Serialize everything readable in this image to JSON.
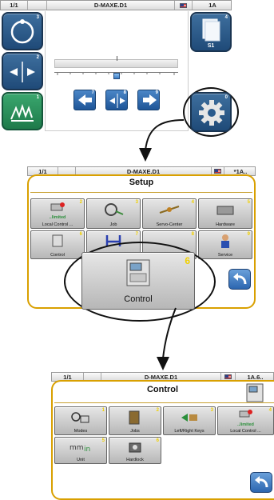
{
  "screen1": {
    "status": {
      "page": "1/1",
      "title": "D-MAXE.D1",
      "right": "1A"
    },
    "side_left": [
      {
        "num": "3"
      },
      {
        "num": "2"
      },
      {
        "num": "1"
      }
    ],
    "side_right": {
      "file_label": "S1",
      "file_num": "4",
      "gear_num": "0"
    },
    "nav_nums": [
      "7",
      "8",
      "9"
    ]
  },
  "screen2": {
    "status": {
      "page": "1/1",
      "title": "D-MAXE.D1",
      "right": "*1A.."
    },
    "title": "Setup",
    "tiles": [
      {
        "num": "2",
        "label": "Local Control ...",
        "limited": "..limited"
      },
      {
        "num": "3",
        "label": "Job"
      },
      {
        "num": "4",
        "label": "Servo-Center"
      },
      {
        "num": "5",
        "label": "Hardware"
      },
      {
        "num": "6",
        "label": "Control"
      },
      {
        "num": "7",
        "label": ""
      },
      {
        "num": "8",
        "label": ""
      },
      {
        "num": "9",
        "label": "Service"
      }
    ],
    "zoom": {
      "num": "6",
      "label": "Control"
    }
  },
  "screen3": {
    "status": {
      "page": "1/1",
      "title": "D-MAXE.D1",
      "right": "1A.6.."
    },
    "title": "Control",
    "tiles": [
      {
        "num": "1",
        "label": "Modes"
      },
      {
        "num": "2",
        "label": "Jobs"
      },
      {
        "num": "3",
        "label": "Left/Right Keys"
      },
      {
        "num": "4",
        "label": "Local Control ...",
        "limited": "..limited"
      },
      {
        "num": "5",
        "label": "Unit"
      },
      {
        "num": "6",
        "label": "Hardlock"
      }
    ]
  },
  "colors": {
    "frame": "#d9a000",
    "side_button": "#2a5a8c",
    "green_button": "#2f9a63",
    "digit": "#f0d000"
  }
}
